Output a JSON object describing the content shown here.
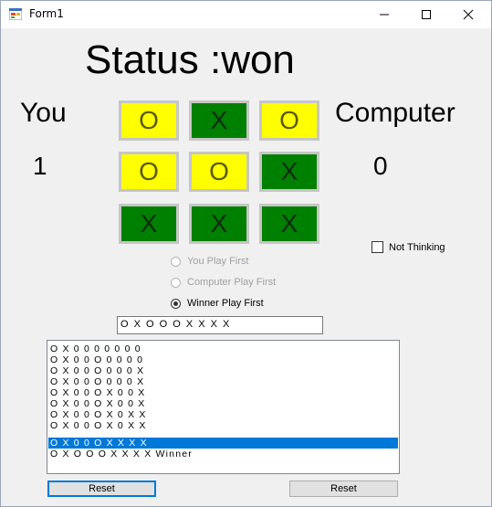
{
  "window": {
    "title": "Form1",
    "icon": "winforms-app-icon",
    "controls": [
      "minimize-icon",
      "maximize-icon",
      "close-icon"
    ]
  },
  "status": "Status :won",
  "players": {
    "you": {
      "label": "You",
      "score": "1"
    },
    "computer": {
      "label": "Computer",
      "score": "0"
    }
  },
  "board": {
    "cells": [
      "O",
      "X",
      "O",
      "O",
      "O",
      "X",
      "X",
      "X",
      "X"
    ],
    "colors": {
      "O": "#ffff00",
      "X": "#008000"
    }
  },
  "not_thinking": {
    "label": "Not Thinking",
    "checked": false
  },
  "play_order": {
    "options": [
      "You Play First",
      "Computer Play First",
      "Winner Play First"
    ],
    "selected": "Winner Play First"
  },
  "sequence_value": "O X O O O X X X X",
  "history": [
    "O X 0 0 0 0 0 0 0",
    "O X 0 0 O 0 0 0 0",
    "O X 0 0 O 0 0 0 X",
    "O X 0 0 O 0 0 0 X",
    "O X 0 0 O X 0 0 X",
    "O X 0 0 O X 0 0 X",
    "O X 0 0 O X 0 X X",
    "O X 0 0 O X 0 X X",
    "O X 0 0 O X X X X",
    "O X O O O X X X X Winner"
  ],
  "history_selected_index": 8,
  "buttons": {
    "reset_left": "Reset",
    "reset_right": "Reset"
  }
}
